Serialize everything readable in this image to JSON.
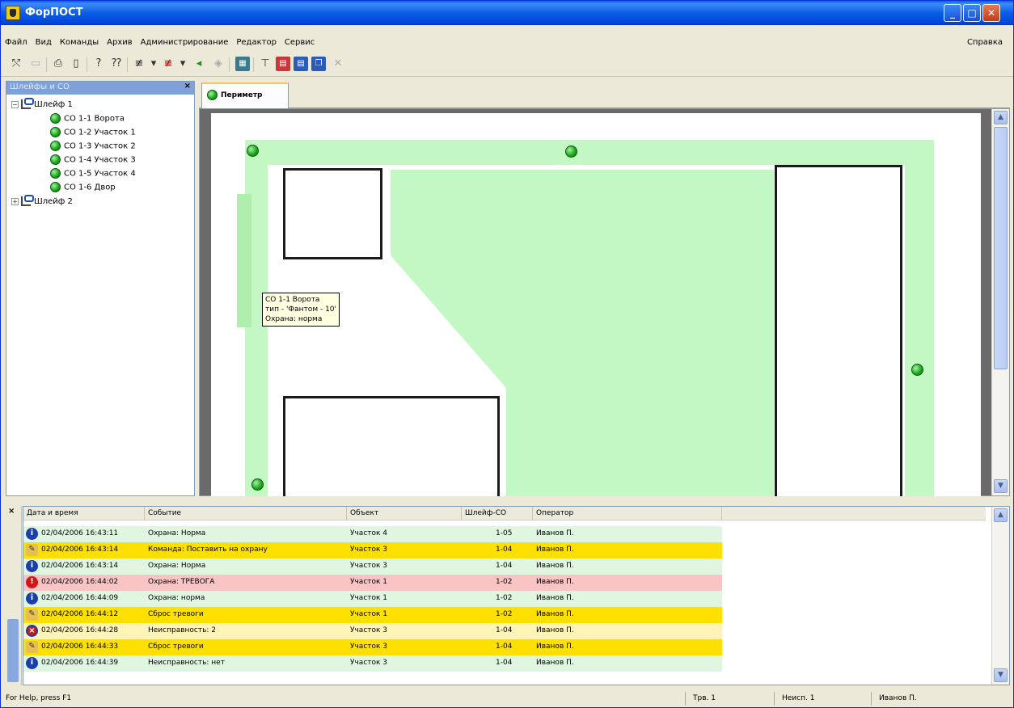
{
  "window": {
    "title": "ФорПОСТ"
  },
  "menu": {
    "items": [
      "Файл",
      "Вид",
      "Команды",
      "Архив",
      "Администрирование",
      "Редактор",
      "Сервис"
    ],
    "help": "Справка"
  },
  "tree": {
    "header": "Шлейфы и СО",
    "loop1": "Шлейф 1",
    "sensors": [
      "СО 1-1 Ворота",
      "СО 1-2 Участок 1",
      "СО 1-3 Участок 2",
      "СО 1-4 Участок 3",
      "СО 1-5 Участок 4",
      "СО 1-6 Двор"
    ],
    "loop2": "Шлейф 2"
  },
  "map": {
    "tab": "Периметр",
    "tooltip": {
      "line1": "СО 1-1 Ворота",
      "line2": "тип - 'Фантом - 10'",
      "line3": "Охрана: норма"
    }
  },
  "log": {
    "columns": [
      "Дата и время",
      "Событие",
      "Объект",
      "Шлейф-СО",
      "Оператор"
    ],
    "rows": [
      {
        "type": "info",
        "time": "02/04/2006 16:43:11",
        "event": "Охрана: Норма",
        "object": "Участок 4",
        "loop": "1-05",
        "operator": "Иванов П."
      },
      {
        "type": "cmd",
        "time": "02/04/2006 16:43:14",
        "event": "Команда: Поставить на охрану",
        "object": "Участок 3",
        "loop": "1-04",
        "operator": "Иванов П."
      },
      {
        "type": "info",
        "time": "02/04/2006 16:43:14",
        "event": "Охрана: Норма",
        "object": "Участок 3",
        "loop": "1-04",
        "operator": "Иванов П."
      },
      {
        "type": "alarm",
        "time": "02/04/2006 16:44:02",
        "event": "Охрана: ТРЕВОГА",
        "object": "Участок 1",
        "loop": "1-02",
        "operator": "Иванов П."
      },
      {
        "type": "info",
        "time": "02/04/2006 16:44:09",
        "event": "Охрана: норма",
        "object": "Участок 1",
        "loop": "1-02",
        "operator": "Иванов П."
      },
      {
        "type": "cmd",
        "time": "02/04/2006 16:44:12",
        "event": "Сброс тревоги",
        "object": "Участок 1",
        "loop": "1-02",
        "operator": "Иванов П."
      },
      {
        "type": "fault",
        "time": "02/04/2006 16:44:28",
        "event": "Неисправность: 2",
        "object": "Участок 3",
        "loop": "1-04",
        "operator": "Иванов П."
      },
      {
        "type": "cmd",
        "time": "02/04/2006 16:44:33",
        "event": "Сброс тревоги",
        "object": "Участок 3",
        "loop": "1-04",
        "operator": "Иванов П."
      },
      {
        "type": "info",
        "time": "02/04/2006 16:44:39",
        "event": "Неисправность: нет",
        "object": "Участок 3",
        "loop": "1-04",
        "operator": "Иванов П."
      }
    ]
  },
  "status": {
    "help": "For Help, press F1",
    "alarms": "Трв. 1",
    "faults": "Неисп. 1",
    "user": "Иванов П."
  },
  "colors": {
    "zone": "#c3f7c3",
    "sensor": "#1caa1c",
    "cmd_row": "#fee000",
    "alarm_row": "#f8c4c4",
    "norm_row": "#e0f6e0",
    "fault_row": "#fff4b8"
  }
}
